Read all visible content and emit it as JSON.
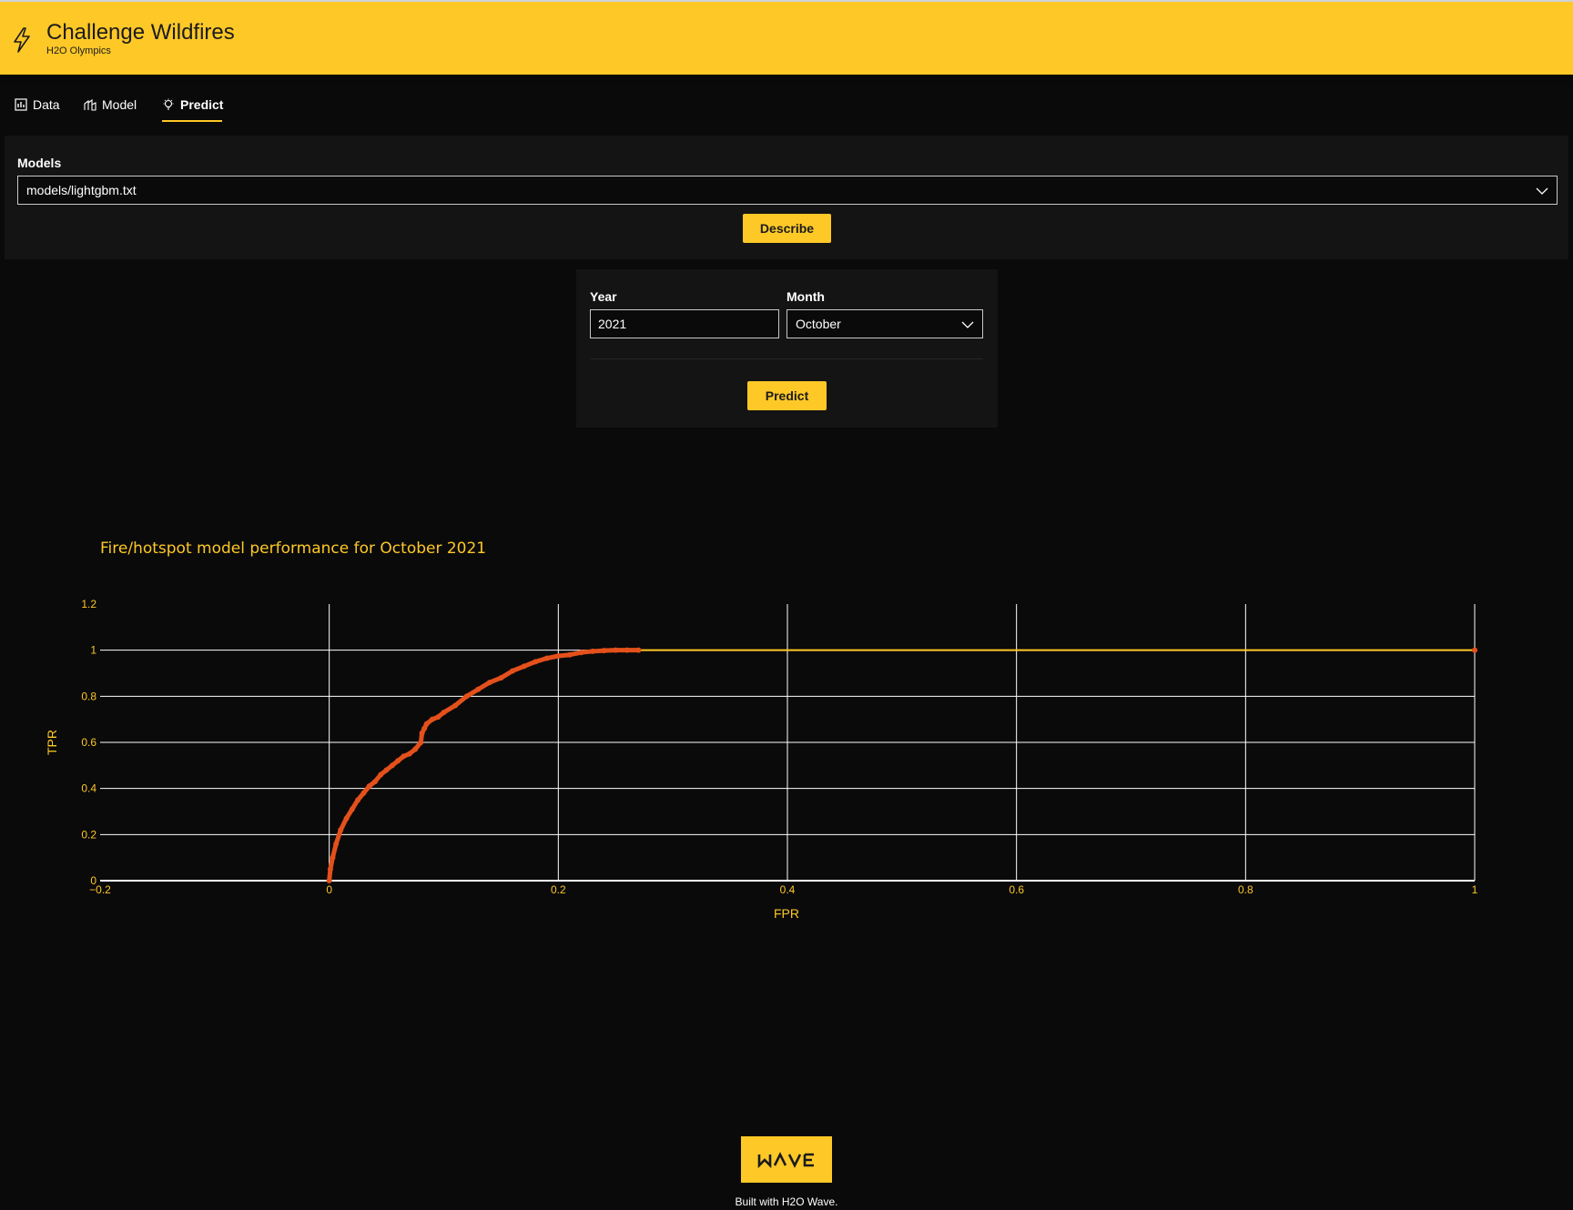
{
  "header": {
    "title": "Challenge Wildfires",
    "subtitle": "H2O Olympics"
  },
  "tabs": [
    {
      "label": "Data",
      "icon": "bar-chart-icon"
    },
    {
      "label": "Model",
      "icon": "build-icon"
    },
    {
      "label": "Predict",
      "icon": "lightbulb-icon",
      "active": true
    }
  ],
  "models_card": {
    "label": "Models",
    "selected": "models/lightgbm.txt",
    "describe_label": "Describe"
  },
  "predict_card": {
    "year_label": "Year",
    "year_value": "2021",
    "month_label": "Month",
    "month_value": "October",
    "predict_label": "Predict"
  },
  "chart_data": {
    "type": "line",
    "title": "Fire/hotspot model performance for October 2021",
    "xlabel": "FPR",
    "ylabel": "TPR",
    "xlim": [
      -0.2,
      1
    ],
    "ylim": [
      0,
      1.2
    ],
    "xticks": [
      "−0.2",
      "0",
      "0.2",
      "0.4",
      "0.6",
      "0.8",
      "1"
    ],
    "yticks": [
      "0",
      "0.2",
      "0.4",
      "0.6",
      "0.8",
      "1",
      "1.2"
    ],
    "grid": true,
    "colors": {
      "line": "#fec827",
      "markers": "#e4501b",
      "text": "#fec827",
      "grid": "#ffffff"
    },
    "series": [
      {
        "x": [
          0,
          0.001,
          0.003,
          0.006,
          0.01,
          0.015,
          0.02,
          0.025,
          0.03,
          0.035,
          0.04,
          0.045,
          0.05,
          0.055,
          0.06,
          0.065,
          0.07,
          0.075,
          0.08,
          0.081,
          0.083,
          0.085,
          0.09,
          0.095,
          0.1,
          0.11,
          0.12,
          0.13,
          0.14,
          0.15,
          0.16,
          0.17,
          0.18,
          0.19,
          0.2,
          0.21,
          0.22,
          0.23,
          0.24,
          0.25,
          0.26,
          0.27,
          1.0
        ],
        "y": [
          0,
          0.05,
          0.1,
          0.16,
          0.22,
          0.27,
          0.31,
          0.35,
          0.38,
          0.41,
          0.43,
          0.46,
          0.48,
          0.5,
          0.52,
          0.54,
          0.55,
          0.57,
          0.6,
          0.64,
          0.66,
          0.68,
          0.7,
          0.71,
          0.73,
          0.76,
          0.8,
          0.83,
          0.86,
          0.88,
          0.91,
          0.93,
          0.95,
          0.965,
          0.975,
          0.98,
          0.99,
          0.995,
          0.998,
          1.0,
          1.0,
          1.0,
          1.0
        ]
      }
    ]
  },
  "footer": {
    "logo_text": "wave",
    "built_with": "Built with H2O Wave."
  }
}
